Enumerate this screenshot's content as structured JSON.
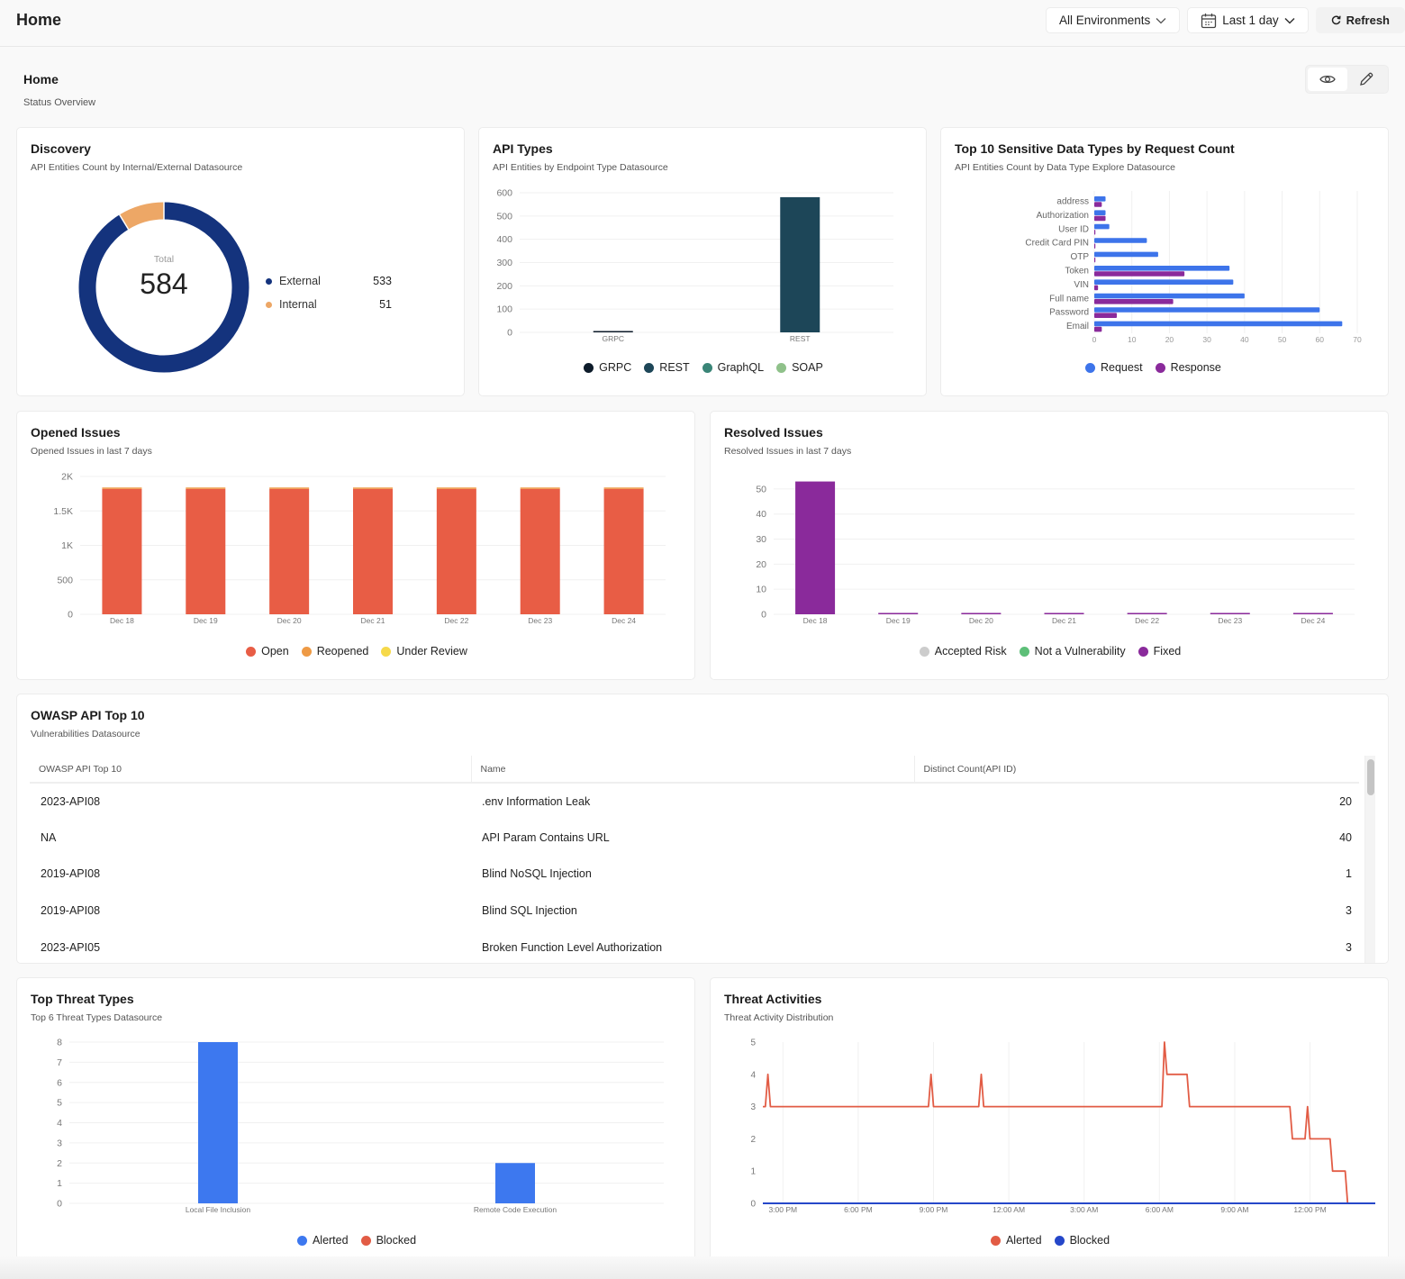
{
  "header": {
    "title": "Home",
    "environment_select": "All Environments",
    "time_range_select": "Last 1 day",
    "refresh_label": "Refresh"
  },
  "dashboard": {
    "title": "Home",
    "subtitle": "Status Overview",
    "view_mode": "view"
  },
  "discovery": {
    "title": "Discovery",
    "subtitle": "API Entities Count by Internal/External Datasource",
    "total_label": "Total",
    "total_value": "584",
    "legend": [
      {
        "label": "External",
        "value": "533",
        "color": "#14337d"
      },
      {
        "label": "Internal",
        "value": "51",
        "color": "#eda766"
      }
    ]
  },
  "api_types": {
    "title": "API Types",
    "subtitle": "API Entities by Endpoint Type Datasource",
    "legend": [
      {
        "label": "GRPC",
        "color": "#0d1b2a"
      },
      {
        "label": "REST",
        "color": "#1d4658"
      },
      {
        "label": "GraphQL",
        "color": "#3a8577"
      },
      {
        "label": "SOAP",
        "color": "#8fc18a"
      }
    ]
  },
  "sensitive": {
    "title": "Top 10 Sensitive Data Types by Request Count",
    "subtitle": "API Entities Count by Data Type Explore Datasource",
    "legend": [
      {
        "label": "Request",
        "color": "#3d74ea"
      },
      {
        "label": "Response",
        "color": "#8a2a9b"
      }
    ]
  },
  "opened": {
    "title": "Opened Issues",
    "subtitle": "Opened Issues in last 7 days",
    "legend": [
      {
        "label": "Open",
        "color": "#e85d45"
      },
      {
        "label": "Reopened",
        "color": "#ee9a45"
      },
      {
        "label": "Under Review",
        "color": "#f6d94a"
      }
    ]
  },
  "resolved": {
    "title": "Resolved Issues",
    "subtitle": "Resolved Issues in last 7 days",
    "legend": [
      {
        "label": "Accepted Risk",
        "color": "#cccccc"
      },
      {
        "label": "Not a Vulnerability",
        "color": "#5dbf78"
      },
      {
        "label": "Fixed",
        "color": "#8a2a9b"
      }
    ]
  },
  "owasp": {
    "title": "OWASP API Top 10",
    "subtitle": "Vulnerabilities Datasource",
    "columns": [
      "OWASP API Top 10",
      "Name",
      "Distinct Count(API ID)"
    ],
    "rows": [
      [
        "2023-API08",
        ".env Information Leak",
        "20"
      ],
      [
        "NA",
        "API Param Contains URL",
        "40"
      ],
      [
        "2019-API08",
        "Blind NoSQL Injection",
        "1"
      ],
      [
        "2019-API08",
        "Blind SQL Injection",
        "3"
      ],
      [
        "2023-API05",
        "Broken Function Level Authorization",
        "3"
      ]
    ]
  },
  "threat_types": {
    "title": "Top Threat Types",
    "subtitle": "Top 6 Threat Types Datasource",
    "legend": [
      {
        "label": "Alerted",
        "color": "#3d78ef"
      },
      {
        "label": "Blocked",
        "color": "#e25c45"
      }
    ]
  },
  "threat_activities": {
    "title": "Threat Activities",
    "subtitle": "Threat Activity Distribution",
    "legend": [
      {
        "label": "Alerted",
        "color": "#e25c45"
      },
      {
        "label": "Blocked",
        "color": "#2547c9"
      }
    ]
  },
  "chart_data": [
    {
      "id": "discovery",
      "type": "pie",
      "title": "Discovery",
      "labels": [
        "External",
        "Internal"
      ],
      "values": [
        533,
        51
      ],
      "center_label": "Total",
      "center_value": 584
    },
    {
      "id": "api_types",
      "type": "bar",
      "title": "API Types",
      "categories": [
        "GRPC",
        "REST"
      ],
      "series": [
        {
          "name": "GRPC",
          "values": [
            3,
            0
          ]
        },
        {
          "name": "REST",
          "values": [
            0,
            581
          ]
        },
        {
          "name": "GraphQL",
          "values": [
            0,
            0
          ]
        },
        {
          "name": "SOAP",
          "values": [
            0,
            0
          ]
        }
      ],
      "yticks": [
        "0",
        "100",
        "200",
        "300",
        "400",
        "500",
        "600"
      ],
      "ylim": [
        0,
        600
      ],
      "legend": "bottom"
    },
    {
      "id": "sensitive",
      "type": "bar",
      "orientation": "horizontal",
      "title": "Top 10 Sensitive Data Types by Request Count",
      "categories": [
        "address",
        "Authorization",
        "User ID",
        "Credit Card PIN",
        "OTP",
        "Token",
        "VIN",
        "Full name",
        "Password",
        "Email"
      ],
      "series": [
        {
          "name": "Request",
          "values": [
            3,
            3,
            4,
            14,
            17,
            36,
            37,
            40,
            60,
            66
          ]
        },
        {
          "name": "Response",
          "values": [
            2,
            3,
            0.2,
            0.2,
            0.2,
            24,
            1,
            21,
            6,
            2
          ]
        }
      ],
      "xticks": [
        "0",
        "10",
        "20",
        "30",
        "40",
        "50",
        "60",
        "70"
      ],
      "xlim": [
        0,
        70
      ],
      "legend": "bottom"
    },
    {
      "id": "opened",
      "type": "bar",
      "stacked": true,
      "title": "Opened Issues",
      "categories": [
        "Dec 18",
        "Dec 19",
        "Dec 20",
        "Dec 21",
        "Dec 22",
        "Dec 23",
        "Dec 24"
      ],
      "series": [
        {
          "name": "Open",
          "values": [
            1820,
            1820,
            1820,
            1820,
            1820,
            1820,
            1820
          ]
        },
        {
          "name": "Reopened",
          "values": [
            10,
            10,
            10,
            10,
            10,
            10,
            10
          ]
        },
        {
          "name": "Under Review",
          "values": [
            0,
            0,
            0,
            0,
            0,
            0,
            0
          ]
        }
      ],
      "yticks": [
        "0",
        "500",
        "1K",
        "1.5K",
        "2K"
      ],
      "ylim": [
        0,
        2000
      ],
      "legend": "bottom"
    },
    {
      "id": "resolved",
      "type": "bar",
      "stacked": true,
      "title": "Resolved Issues",
      "categories": [
        "Dec 18",
        "Dec 19",
        "Dec 20",
        "Dec 21",
        "Dec 22",
        "Dec 23",
        "Dec 24"
      ],
      "series": [
        {
          "name": "Accepted Risk",
          "values": [
            0,
            0,
            0,
            0,
            0,
            0,
            0
          ]
        },
        {
          "name": "Not a Vulnerability",
          "values": [
            0,
            0,
            0,
            0,
            0,
            0,
            0
          ]
        },
        {
          "name": "Fixed",
          "values": [
            53,
            0.5,
            0.5,
            0.5,
            0.5,
            0.5,
            0.5
          ]
        }
      ],
      "yticks": [
        "0",
        "10",
        "20",
        "30",
        "40",
        "50"
      ],
      "ylim": [
        0,
        55
      ],
      "legend": "bottom"
    },
    {
      "id": "threat_types",
      "type": "bar",
      "title": "Top Threat Types",
      "categories": [
        "Local File Inclusion",
        "Remote Code Execution"
      ],
      "series": [
        {
          "name": "Alerted",
          "values": [
            8,
            2
          ]
        },
        {
          "name": "Blocked",
          "values": [
            0,
            0
          ]
        }
      ],
      "yticks": [
        "0",
        "1",
        "2",
        "3",
        "4",
        "5",
        "6",
        "7",
        "8"
      ],
      "ylim": [
        0,
        8
      ],
      "legend": "bottom"
    },
    {
      "id": "threat_activities",
      "type": "line",
      "title": "Threat Activities",
      "x_unit": "hours since 1:00 PM",
      "xticks": [
        {
          "label": "3:00 PM",
          "x": 2
        },
        {
          "label": "6:00 PM",
          "x": 5
        },
        {
          "label": "9:00 PM",
          "x": 8
        },
        {
          "label": "12:00 AM",
          "x": 11
        },
        {
          "label": "3:00 AM",
          "x": 14
        },
        {
          "label": "6:00 AM",
          "x": 17
        },
        {
          "label": "9:00 AM",
          "x": 20
        },
        {
          "label": "12:00 PM",
          "x": 23
        }
      ],
      "xlim": [
        1.2,
        25.6
      ],
      "yticks": [
        "0",
        "1",
        "2",
        "3",
        "4",
        "5"
      ],
      "ylim": [
        0,
        5
      ],
      "series": [
        {
          "name": "Alerted",
          "points": [
            [
              1.2,
              3
            ],
            [
              1.3,
              3
            ],
            [
              1.4,
              4
            ],
            [
              1.5,
              3
            ],
            [
              7.8,
              3
            ],
            [
              7.9,
              4
            ],
            [
              8.0,
              3
            ],
            [
              9.8,
              3
            ],
            [
              9.9,
              4
            ],
            [
              10.0,
              3
            ],
            [
              17.1,
              3
            ],
            [
              17.2,
              5
            ],
            [
              17.3,
              4
            ],
            [
              18.1,
              4
            ],
            [
              18.2,
              3
            ],
            [
              22.2,
              3
            ],
            [
              22.3,
              2
            ],
            [
              22.8,
              2
            ],
            [
              22.9,
              3
            ],
            [
              23.0,
              2
            ],
            [
              23.8,
              2
            ],
            [
              23.9,
              1
            ],
            [
              24.4,
              1
            ],
            [
              24.5,
              0
            ]
          ]
        },
        {
          "name": "Blocked",
          "points": [
            [
              1.2,
              0
            ],
            [
              25.6,
              0
            ]
          ]
        }
      ],
      "legend": "bottom"
    }
  ]
}
